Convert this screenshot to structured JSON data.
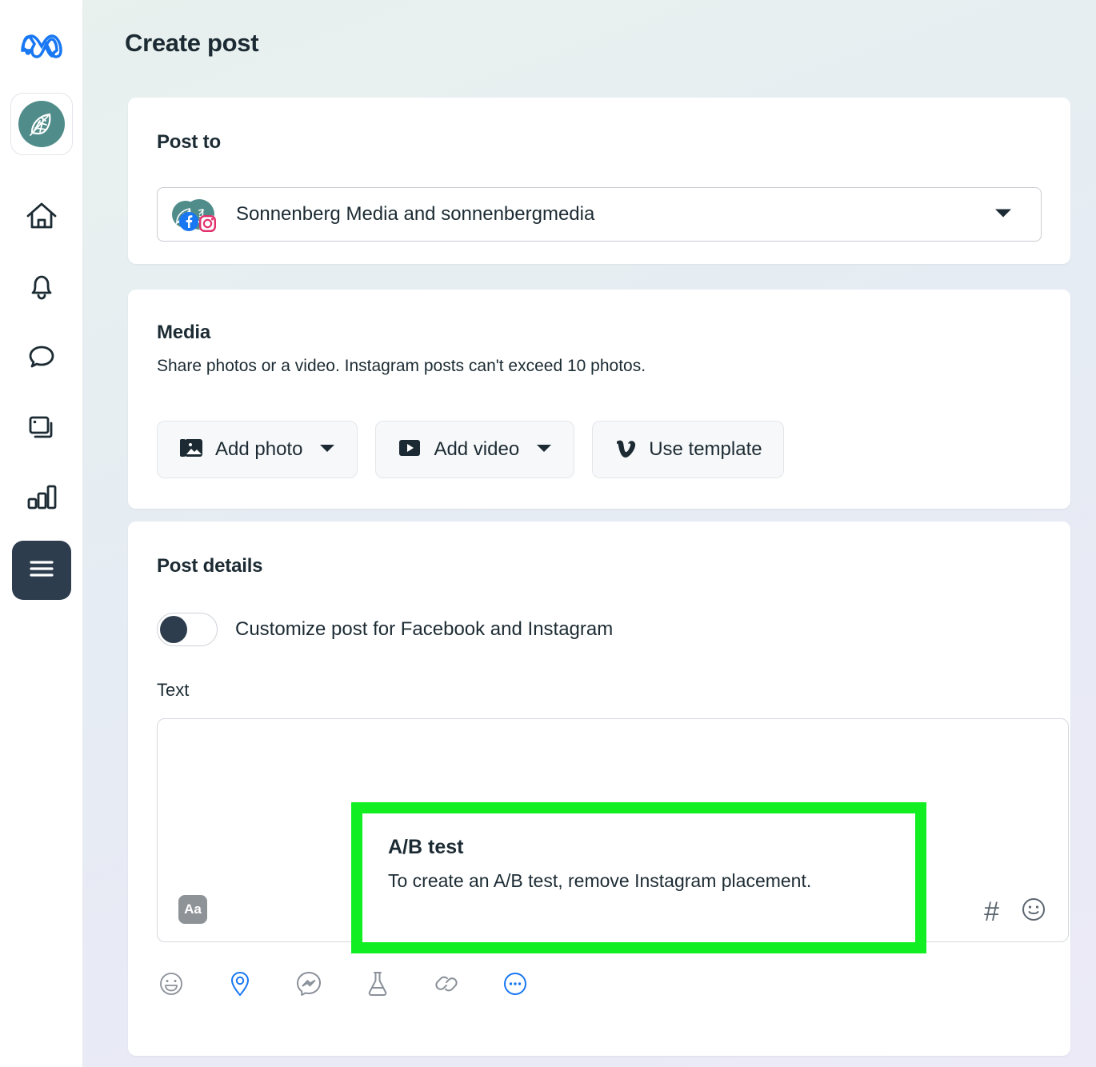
{
  "sidebar": {
    "logo": "meta-logo",
    "brand_avatar": "sonnenberg-media-avatar",
    "items": [
      {
        "icon": "home-icon",
        "name": "home"
      },
      {
        "icon": "bell-icon",
        "name": "notifications"
      },
      {
        "icon": "chat-bubble-icon",
        "name": "messages"
      },
      {
        "icon": "posts-icon",
        "name": "posts"
      },
      {
        "icon": "bar-chart-icon",
        "name": "insights"
      }
    ],
    "menu_button": {
      "icon": "hamburger-menu-icon",
      "name": "all-tools",
      "active": true
    }
  },
  "header": {
    "title": "Create post"
  },
  "post_to": {
    "section_title": "Post to",
    "selected_value": "Sonnenberg Media and sonnenbergmedia",
    "caret": "chevron-down-icon",
    "avatars": [
      "facebook-page-avatar",
      "instagram-account-avatar"
    ]
  },
  "media": {
    "section_title": "Media",
    "description": "Share photos or a video. Instagram posts can't exceed 10 photos.",
    "buttons": [
      {
        "label": "Add photo",
        "icon": "photo-icon",
        "caret": true
      },
      {
        "label": "Add video",
        "icon": "video-play-icon",
        "caret": true
      },
      {
        "label": "Use template",
        "icon": "vimeo-v-icon",
        "caret": false
      }
    ]
  },
  "post_details": {
    "section_title": "Post details",
    "toggle": {
      "label": "Customize post for Facebook and Instagram",
      "state": "off"
    },
    "text_field": {
      "label": "Text",
      "value": "",
      "placeholder": "",
      "font_button": "Aa",
      "right_icons": [
        {
          "icon": "hashtag-icon",
          "glyph": "#"
        },
        {
          "icon": "emoji-smiley-icon"
        }
      ]
    },
    "toolbar": [
      {
        "icon": "emoji-face-icon",
        "color": "#8a9099"
      },
      {
        "icon": "location-pin-icon",
        "color": "#1877f2"
      },
      {
        "icon": "messenger-icon",
        "color": "#8a9099"
      },
      {
        "icon": "flask-ab-test-icon",
        "color": "#8a9099"
      },
      {
        "icon": "link-icon",
        "color": "#8a9099"
      },
      {
        "icon": "more-options-icon",
        "color": "#1877f2"
      }
    ]
  },
  "ab_test_tooltip": {
    "title": "A/B test",
    "body": "To create an A/B test, remove Instagram placement.",
    "highlight_color": "#11ee22"
  },
  "colors": {
    "meta_blue": "#1877f2",
    "brand_teal": "#4f8c8a",
    "text_dark": "#1c2b33",
    "rail_active": "#2d3d4e",
    "highlight_green": "#11ee22"
  }
}
